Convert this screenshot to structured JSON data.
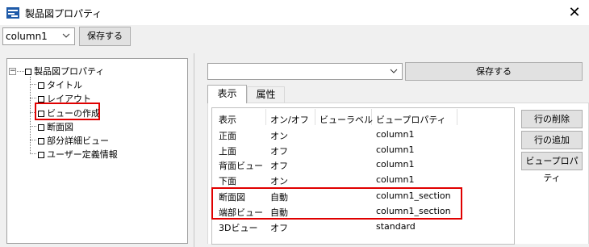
{
  "window": {
    "title": "製品図プロパティ",
    "close_glyph": "✕"
  },
  "toolbar": {
    "combo_value": "column1",
    "save_label": "保存する"
  },
  "right_toolbar": {
    "combo_value": "",
    "save_label": "保存する"
  },
  "tree": {
    "root": "製品図プロパティ",
    "expander_glyph": "−",
    "children": [
      "タイトル",
      "レイアウト",
      "ビューの作成",
      "断面図",
      "部分詳細ビュー",
      "ユーザー定義情報"
    ]
  },
  "tabs": [
    "表示",
    "属性"
  ],
  "table": {
    "headers": [
      "表示",
      "オン/オフ",
      "ビューラベル",
      "ビュープロパティ"
    ],
    "rows": [
      [
        "正面",
        "オン",
        "",
        "column1"
      ],
      [
        "上面",
        "オフ",
        "",
        "column1"
      ],
      [
        "背面ビュー",
        "オフ",
        "",
        "column1"
      ],
      [
        "下面",
        "オン",
        "",
        "column1"
      ],
      [
        "断面図",
        "自動",
        "",
        "column1_section"
      ],
      [
        "端部ビュー",
        "自動",
        "",
        "column1_section"
      ],
      [
        "3Dビュー",
        "オフ",
        "",
        "standard"
      ]
    ]
  },
  "side_buttons": [
    "行の削除",
    "行の追加",
    "ビュープロパティ"
  ],
  "colors": {
    "highlight": "#e00000",
    "icon_blue": "#1e5aa8"
  }
}
